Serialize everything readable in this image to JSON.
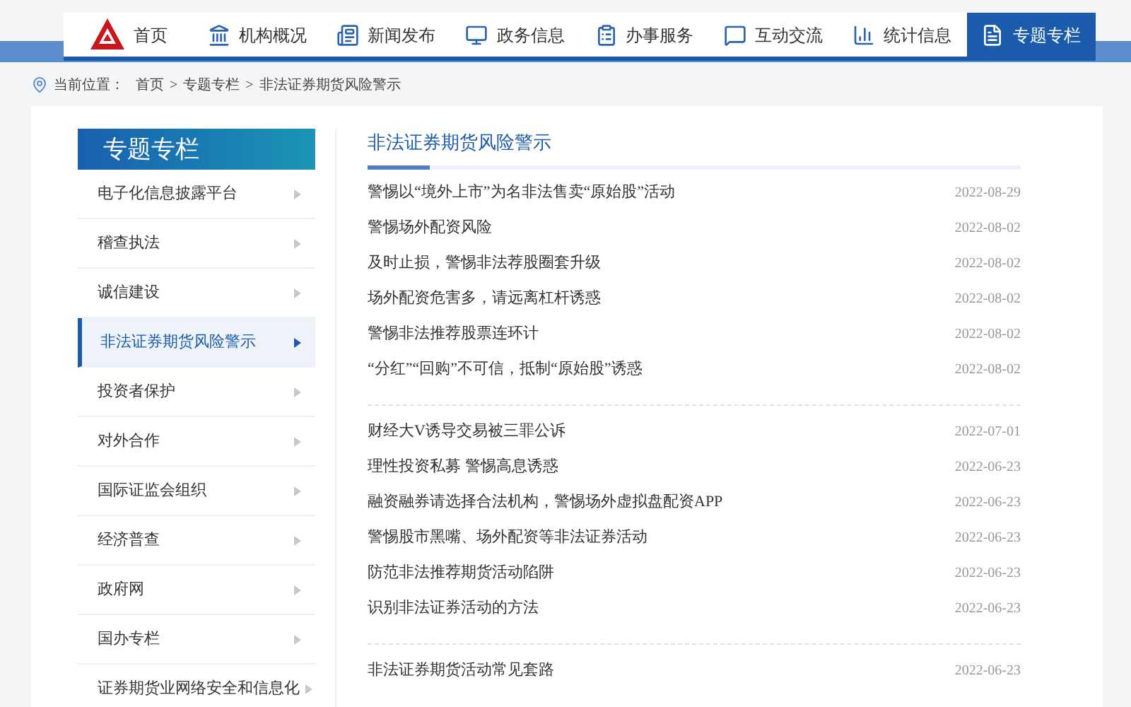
{
  "nav": [
    {
      "label": "首页",
      "selected": false
    },
    {
      "label": "机构概况",
      "selected": false
    },
    {
      "label": "新闻发布",
      "selected": false
    },
    {
      "label": "政务信息",
      "selected": false
    },
    {
      "label": "办事服务",
      "selected": false
    },
    {
      "label": "互动交流",
      "selected": false
    },
    {
      "label": "统计信息",
      "selected": false
    },
    {
      "label": "专题专栏",
      "selected": true
    }
  ],
  "breadcrumb": {
    "label": "当前位置：",
    "items": [
      "首页",
      "专题专栏",
      "非法证券期货风险警示"
    ],
    "separator": ">"
  },
  "sidebar": {
    "title": "专题专栏",
    "items": [
      {
        "label": "电子化信息披露平台",
        "selected": false
      },
      {
        "label": "稽查执法",
        "selected": false
      },
      {
        "label": "诚信建设",
        "selected": false
      },
      {
        "label": "非法证券期货风险警示",
        "selected": true
      },
      {
        "label": "投资者保护",
        "selected": false
      },
      {
        "label": "对外合作",
        "selected": false
      },
      {
        "label": "国际证监会组织",
        "selected": false
      },
      {
        "label": "经济普查",
        "selected": false
      },
      {
        "label": "政府网",
        "selected": false
      },
      {
        "label": "国办专栏",
        "selected": false
      },
      {
        "label": "证券期货业网络安全和信息化",
        "selected": false
      }
    ]
  },
  "content": {
    "title": "非法证券期货风险警示",
    "groups": [
      [
        {
          "title": "警惕以“境外上市”为名非法售卖“原始股”活动",
          "date": "2022-08-29"
        },
        {
          "title": "警惕场外配资风险",
          "date": "2022-08-02"
        },
        {
          "title": "及时止损，警惕非法荐股圈套升级",
          "date": "2022-08-02"
        },
        {
          "title": "场外配资危害多，请远离杠杆诱惑",
          "date": "2022-08-02"
        },
        {
          "title": "警惕非法推荐股票连环计",
          "date": "2022-08-02"
        },
        {
          "title": "“分红”“回购”不可信，抵制“原始股”诱惑",
          "date": "2022-08-02"
        }
      ],
      [
        {
          "title": "财经大V诱导交易被三罪公诉",
          "date": "2022-07-01"
        },
        {
          "title": "理性投资私募 警惕高息诱惑",
          "date": "2022-06-23"
        },
        {
          "title": "融资融券请选择合法机构，警惕场外虚拟盘配资APP",
          "date": "2022-06-23"
        },
        {
          "title": "警惕股市黑嘴、场外配资等非法证券活动",
          "date": "2022-06-23"
        },
        {
          "title": "防范非法推荐期货活动陷阱",
          "date": "2022-06-23"
        },
        {
          "title": "识别非法证券活动的方法",
          "date": "2022-06-23"
        }
      ],
      [
        {
          "title": "非法证券期货活动常见套路",
          "date": "2022-06-23"
        }
      ]
    ]
  }
}
